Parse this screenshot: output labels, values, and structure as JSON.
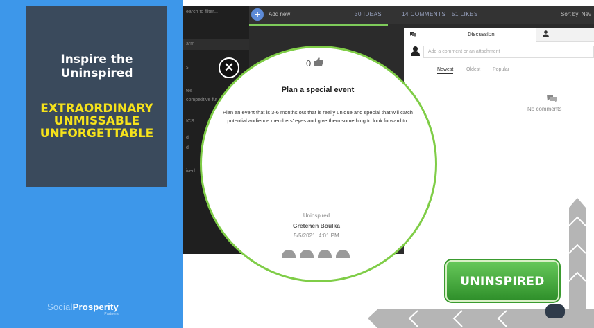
{
  "slide": {
    "title": "Inspire the Uninspired",
    "subtitle_lines": [
      "EXTRAORDINARY",
      "UNMISSABLE",
      "UNFORGETTABLE"
    ],
    "brand": {
      "part1": "Social",
      "part2": "Prosperity",
      "tagline": "Partners"
    },
    "badge_label": "UNINSPIRED",
    "colors": {
      "panel_blue": "#3d97ea",
      "card_slate": "#3a4a5c",
      "accent_yellow": "#f6e21b",
      "badge_green": "#4caf3f",
      "circle_border": "#7fcd47"
    }
  },
  "app": {
    "sidebar_items": [
      "earch to filter...",
      "arm",
      "s",
      "tes",
      "competitive fut",
      "ICS",
      "d",
      "d",
      "ived"
    ],
    "toolbar": {
      "add_new_label": "Add new",
      "ideas_stat": "30 IDEAS",
      "comments_stat": "14 COMMENTS",
      "likes_stat": "51 LIKES",
      "sort_label": "Sort by: Nev"
    },
    "discussion": {
      "tab_discussion_icon": "comments-icon",
      "tab_label": "Discussion",
      "tab_people_icon": "user-icon",
      "comment_placeholder": "Add a comment or an attachment",
      "sort_tabs": [
        "Newest",
        "Oldest",
        "Popular"
      ],
      "empty_icon": "comments-icon",
      "empty_text": "No comments"
    },
    "idea": {
      "like_count": "0",
      "like_icon": "thumbs-up-icon",
      "title": "Plan a special event",
      "description": "Plan an event that is 3-6 months out that is really unique and special that will catch potential audience members' eyes and give them something to look forward to.",
      "category": "Uninspired",
      "author": "Gretchen Boulka",
      "date": "5/5/2021, 4:01 PM",
      "close_icon": "close-icon"
    }
  }
}
